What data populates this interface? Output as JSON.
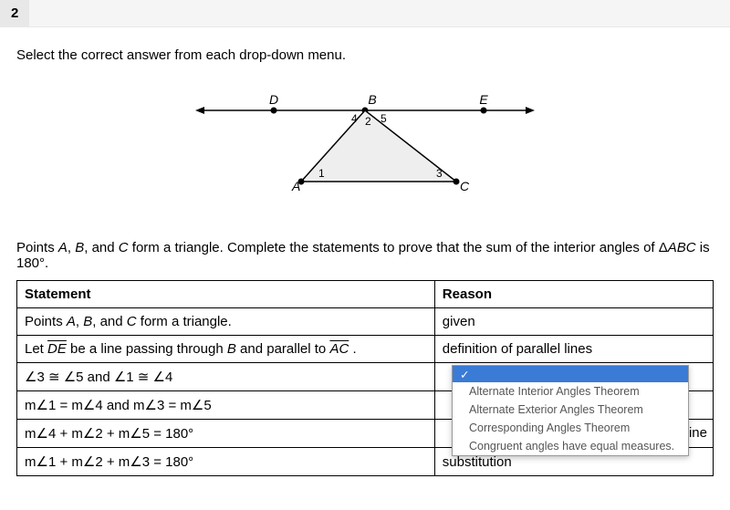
{
  "question_number": "2",
  "instruction": "Select the correct answer from each drop-down menu.",
  "figure": {
    "labels": {
      "A": "A",
      "B": "B",
      "C": "C",
      "D": "D",
      "E": "E"
    },
    "angle_labels": {
      "a1": "1",
      "a2": "2",
      "a3": "3",
      "a4": "4",
      "a5": "5"
    }
  },
  "prompt_pre": "Points ",
  "prompt_A": "A",
  "prompt_sep1": ", ",
  "prompt_B": "B",
  "prompt_sep2": ", and ",
  "prompt_C": "C",
  "prompt_mid": " form a triangle. Complete the statements to prove that the sum of the interior angles of Δ",
  "prompt_ABC": "ABC",
  "prompt_end": " is 180°.",
  "headers": {
    "statement": "Statement",
    "reason": "Reason"
  },
  "rows": [
    {
      "st_pre": "Points ",
      "st_A": "A",
      "st_s1": ", ",
      "st_B": "B",
      "st_s2": ", and ",
      "st_C": "C",
      "st_post": " form a triangle.",
      "reason": "given"
    },
    {
      "let": "Let ",
      "de": "DE",
      "mid": " be a line passing through ",
      "bb": "B",
      "mid2": " and parallel to ",
      "ac": "AC",
      "dot": " .",
      "reason": "definition of parallel lines"
    },
    {
      "stmt": "∠3 ≅ ∠5 and ∠1 ≅ ∠4",
      "reason": ""
    },
    {
      "stmt": "m∠1 = m∠4 and m∠3 = m∠5",
      "reason": ""
    },
    {
      "stmt": "m∠4 + m∠2 + m∠5 = 180°",
      "reason_suffix": "straight line"
    },
    {
      "stmt": "m∠1 + m∠2 + m∠3 = 180°",
      "reason": "substitution"
    }
  ],
  "dropdown": {
    "check": "✓",
    "options": [
      "Alternate Interior Angles Theorem",
      "Alternate Exterior Angles Theorem",
      "Corresponding Angles Theorem",
      "Congruent angles have equal measures."
    ]
  }
}
